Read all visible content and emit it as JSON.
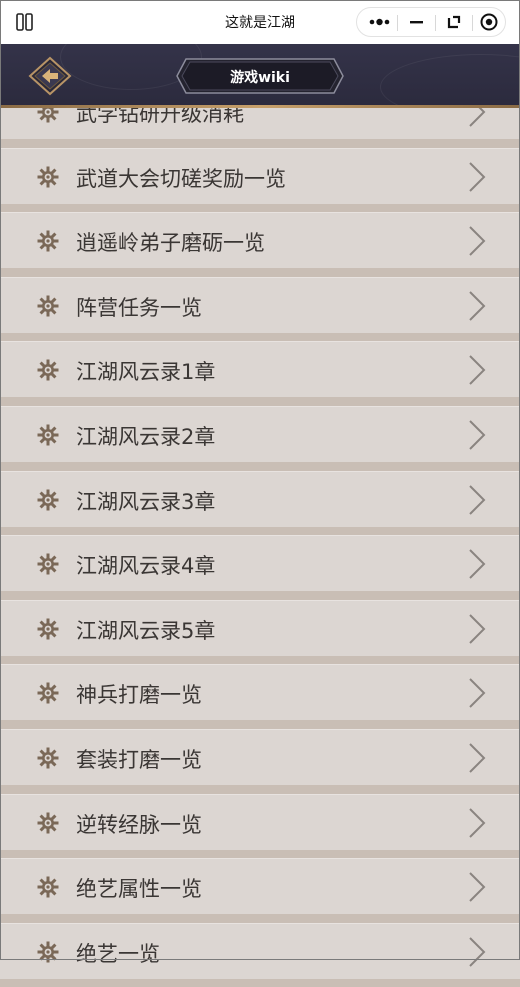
{
  "app": {
    "window_title": "这就是江湖"
  },
  "header": {
    "title": "游戏wiki"
  },
  "icons": {
    "sidebar": "sidebar-toggle-icon",
    "more": "more-dots-icon",
    "minimize": "minimize-icon",
    "restore": "restore-icon",
    "close": "record-close-icon",
    "back": "back-arrow-icon",
    "item": "gear-icon",
    "chevron": "chevron-right-icon"
  },
  "colors": {
    "header_bg": "#2f2e42",
    "gold_accent": "#c7a06b",
    "row_bg": "#dcd6d2",
    "gap_bg": "#c9beb5",
    "text": "#3a3634"
  },
  "list": {
    "items": [
      {
        "label": "武学钻研升级消耗"
      },
      {
        "label": "武道大会切磋奖励一览"
      },
      {
        "label": "逍遥岭弟子磨砺一览"
      },
      {
        "label": "阵营任务一览"
      },
      {
        "label": "江湖风云录1章"
      },
      {
        "label": "江湖风云录2章"
      },
      {
        "label": "江湖风云录3章"
      },
      {
        "label": "江湖风云录4章"
      },
      {
        "label": "江湖风云录5章"
      },
      {
        "label": "神兵打磨一览"
      },
      {
        "label": "套装打磨一览"
      },
      {
        "label": "逆转经脉一览"
      },
      {
        "label": "绝艺属性一览"
      },
      {
        "label": "绝艺一览"
      }
    ]
  }
}
